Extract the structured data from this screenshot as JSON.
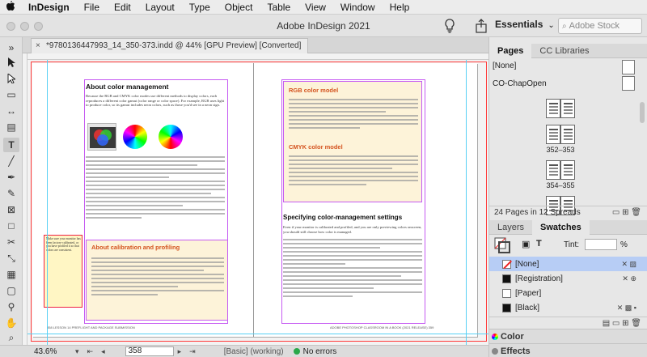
{
  "menubar": {
    "apple": "",
    "items": [
      "InDesign",
      "File",
      "Edit",
      "Layout",
      "Type",
      "Object",
      "Table",
      "View",
      "Window",
      "Help"
    ]
  },
  "app": {
    "title": "Adobe InDesign 2021",
    "workspace": "Essentials",
    "stock_placeholder": "Adobe Stock"
  },
  "document_tab": {
    "label": "*9780136447993_14_350-373.indd @ 44% [GPU Preview] [Converted]",
    "close": "×"
  },
  "spread": {
    "left_title": "About color management",
    "right_title_1": "RGB color model",
    "right_title_2": "CMYK color model",
    "right_heading": "Specifying color-management settings",
    "box_title": "About calibration and profiling",
    "left_footer": "358   LESSON 14   PREFLIGHT AND PACKAGE SUBMISSION",
    "right_footer": "ADOBE PHOTOSHOP CLASSROOM IN A BOOK (2021 RELEASE)   359",
    "left_intro": "Because the RGB and CMYK color modes use different methods to display colors, each reproduces a different color gamut (color range or color space). For example, RGB uses light to produce color, so its gamut includes neon colors, such as those you'd see in a neon sign.",
    "right_intro": "Even if your monitor is calibrated and profiled, and you are only previewing colors onscreen, you should still choose how color is managed.",
    "note_text": "Make sure your monitor has been factory-calibrated, or you have profiled it so that colors are consistent."
  },
  "statusbar": {
    "zoom": "43.6%",
    "page": "358",
    "preflight_profile": "[Basic] (working)",
    "errors": "No errors"
  },
  "pages_panel": {
    "tabs": [
      "Pages",
      "CC Libraries"
    ],
    "master_none": "[None]",
    "master_a": "CO-ChapOpen",
    "spread_labels": [
      "352–353",
      "354–355"
    ],
    "summary": "24 Pages in 12 Spreads"
  },
  "swatches_panel": {
    "tabs": [
      "Layers",
      "Swatches"
    ],
    "tint_label": "Tint:",
    "tint_value": "",
    "percent": "%",
    "rows": [
      "[None]",
      "[Registration]",
      "[Paper]",
      "[Black]"
    ]
  },
  "collapsed_panels": [
    "Color",
    "Effects"
  ],
  "colors": {
    "accent_orange": "#d4531f",
    "box_fill": "#fdf3d9",
    "guide_magenta": "#c65cf2",
    "selection_blue": "#b7cdf5"
  }
}
